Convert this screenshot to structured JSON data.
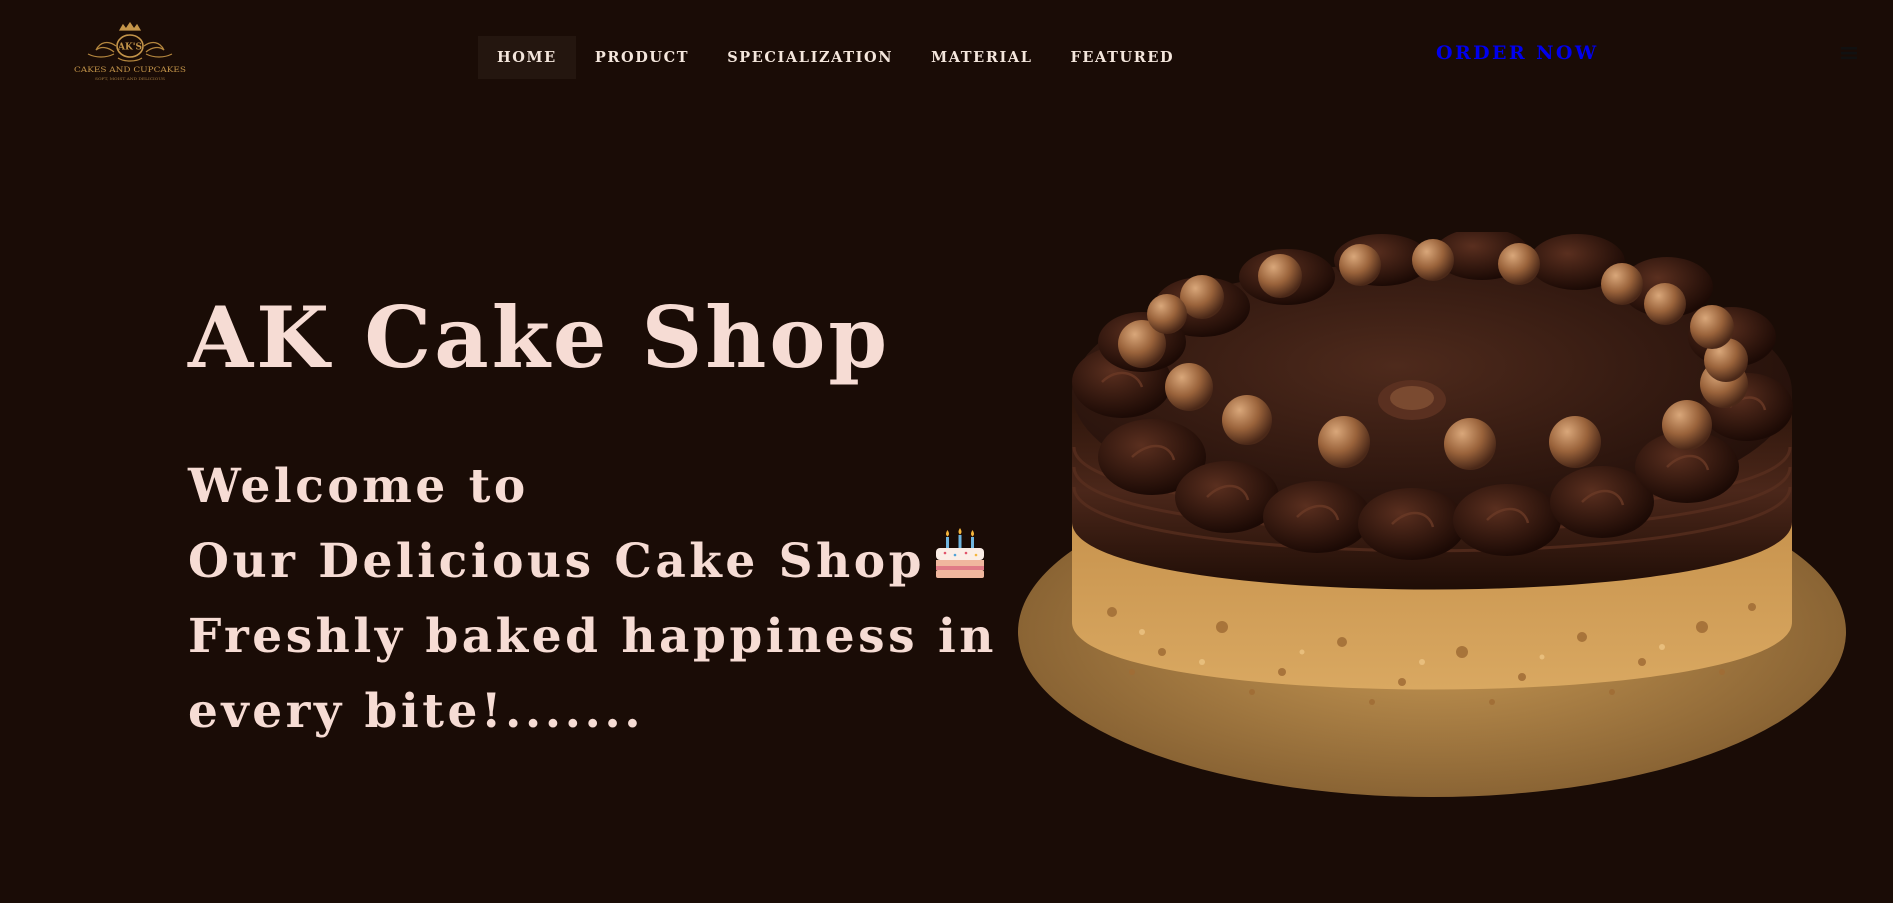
{
  "logo": {
    "icon": "cake-shop-crest-logo",
    "monogram": "AK'S",
    "brand_text": "CAKES AND CUPCAKES",
    "tagline": "SOFT, MOIST AND DELICIOUS"
  },
  "nav": {
    "items": [
      {
        "label": "HOME",
        "active": true
      },
      {
        "label": "PRODUCT",
        "active": false
      },
      {
        "label": "SPECIALIZATION",
        "active": false
      },
      {
        "label": "MATERIAL",
        "active": false
      },
      {
        "label": "FEATURED",
        "active": false
      }
    ]
  },
  "header": {
    "order_label": "ORDER NOW",
    "menu_icon": "hamburger-menu-icon"
  },
  "hero": {
    "title": "AK Cake Shop",
    "lines": [
      "Welcome to",
      "Our Delicious Cake Shop",
      "Freshly baked happiness in",
      "every bite!......."
    ],
    "emoji_icon": "birthday-cake-emoji-icon",
    "image": "chocolate-cake-image"
  },
  "colors": {
    "background": "#1a0c06",
    "nav_text": "#f4e6dc",
    "active_nav_bg": "#24160f",
    "order_link": "#0000ee",
    "hero_text": "#f6dcd4"
  }
}
